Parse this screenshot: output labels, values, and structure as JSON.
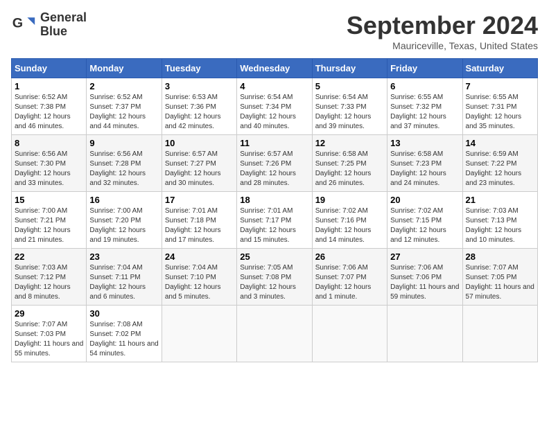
{
  "logo": {
    "line1": "General",
    "line2": "Blue"
  },
  "title": "September 2024",
  "location": "Mauriceville, Texas, United States",
  "weekdays": [
    "Sunday",
    "Monday",
    "Tuesday",
    "Wednesday",
    "Thursday",
    "Friday",
    "Saturday"
  ],
  "weeks": [
    [
      {
        "day": "1",
        "sunrise": "6:52 AM",
        "sunset": "7:38 PM",
        "daylight": "12 hours and 46 minutes."
      },
      {
        "day": "2",
        "sunrise": "6:52 AM",
        "sunset": "7:37 PM",
        "daylight": "12 hours and 44 minutes."
      },
      {
        "day": "3",
        "sunrise": "6:53 AM",
        "sunset": "7:36 PM",
        "daylight": "12 hours and 42 minutes."
      },
      {
        "day": "4",
        "sunrise": "6:54 AM",
        "sunset": "7:34 PM",
        "daylight": "12 hours and 40 minutes."
      },
      {
        "day": "5",
        "sunrise": "6:54 AM",
        "sunset": "7:33 PM",
        "daylight": "12 hours and 39 minutes."
      },
      {
        "day": "6",
        "sunrise": "6:55 AM",
        "sunset": "7:32 PM",
        "daylight": "12 hours and 37 minutes."
      },
      {
        "day": "7",
        "sunrise": "6:55 AM",
        "sunset": "7:31 PM",
        "daylight": "12 hours and 35 minutes."
      }
    ],
    [
      {
        "day": "8",
        "sunrise": "6:56 AM",
        "sunset": "7:30 PM",
        "daylight": "12 hours and 33 minutes."
      },
      {
        "day": "9",
        "sunrise": "6:56 AM",
        "sunset": "7:28 PM",
        "daylight": "12 hours and 32 minutes."
      },
      {
        "day": "10",
        "sunrise": "6:57 AM",
        "sunset": "7:27 PM",
        "daylight": "12 hours and 30 minutes."
      },
      {
        "day": "11",
        "sunrise": "6:57 AM",
        "sunset": "7:26 PM",
        "daylight": "12 hours and 28 minutes."
      },
      {
        "day": "12",
        "sunrise": "6:58 AM",
        "sunset": "7:25 PM",
        "daylight": "12 hours and 26 minutes."
      },
      {
        "day": "13",
        "sunrise": "6:58 AM",
        "sunset": "7:23 PM",
        "daylight": "12 hours and 24 minutes."
      },
      {
        "day": "14",
        "sunrise": "6:59 AM",
        "sunset": "7:22 PM",
        "daylight": "12 hours and 23 minutes."
      }
    ],
    [
      {
        "day": "15",
        "sunrise": "7:00 AM",
        "sunset": "7:21 PM",
        "daylight": "12 hours and 21 minutes."
      },
      {
        "day": "16",
        "sunrise": "7:00 AM",
        "sunset": "7:20 PM",
        "daylight": "12 hours and 19 minutes."
      },
      {
        "day": "17",
        "sunrise": "7:01 AM",
        "sunset": "7:18 PM",
        "daylight": "12 hours and 17 minutes."
      },
      {
        "day": "18",
        "sunrise": "7:01 AM",
        "sunset": "7:17 PM",
        "daylight": "12 hours and 15 minutes."
      },
      {
        "day": "19",
        "sunrise": "7:02 AM",
        "sunset": "7:16 PM",
        "daylight": "12 hours and 14 minutes."
      },
      {
        "day": "20",
        "sunrise": "7:02 AM",
        "sunset": "7:15 PM",
        "daylight": "12 hours and 12 minutes."
      },
      {
        "day": "21",
        "sunrise": "7:03 AM",
        "sunset": "7:13 PM",
        "daylight": "12 hours and 10 minutes."
      }
    ],
    [
      {
        "day": "22",
        "sunrise": "7:03 AM",
        "sunset": "7:12 PM",
        "daylight": "12 hours and 8 minutes."
      },
      {
        "day": "23",
        "sunrise": "7:04 AM",
        "sunset": "7:11 PM",
        "daylight": "12 hours and 6 minutes."
      },
      {
        "day": "24",
        "sunrise": "7:04 AM",
        "sunset": "7:10 PM",
        "daylight": "12 hours and 5 minutes."
      },
      {
        "day": "25",
        "sunrise": "7:05 AM",
        "sunset": "7:08 PM",
        "daylight": "12 hours and 3 minutes."
      },
      {
        "day": "26",
        "sunrise": "7:06 AM",
        "sunset": "7:07 PM",
        "daylight": "12 hours and 1 minute."
      },
      {
        "day": "27",
        "sunrise": "7:06 AM",
        "sunset": "7:06 PM",
        "daylight": "11 hours and 59 minutes."
      },
      {
        "day": "28",
        "sunrise": "7:07 AM",
        "sunset": "7:05 PM",
        "daylight": "11 hours and 57 minutes."
      }
    ],
    [
      {
        "day": "29",
        "sunrise": "7:07 AM",
        "sunset": "7:03 PM",
        "daylight": "11 hours and 55 minutes."
      },
      {
        "day": "30",
        "sunrise": "7:08 AM",
        "sunset": "7:02 PM",
        "daylight": "11 hours and 54 minutes."
      },
      null,
      null,
      null,
      null,
      null
    ]
  ]
}
